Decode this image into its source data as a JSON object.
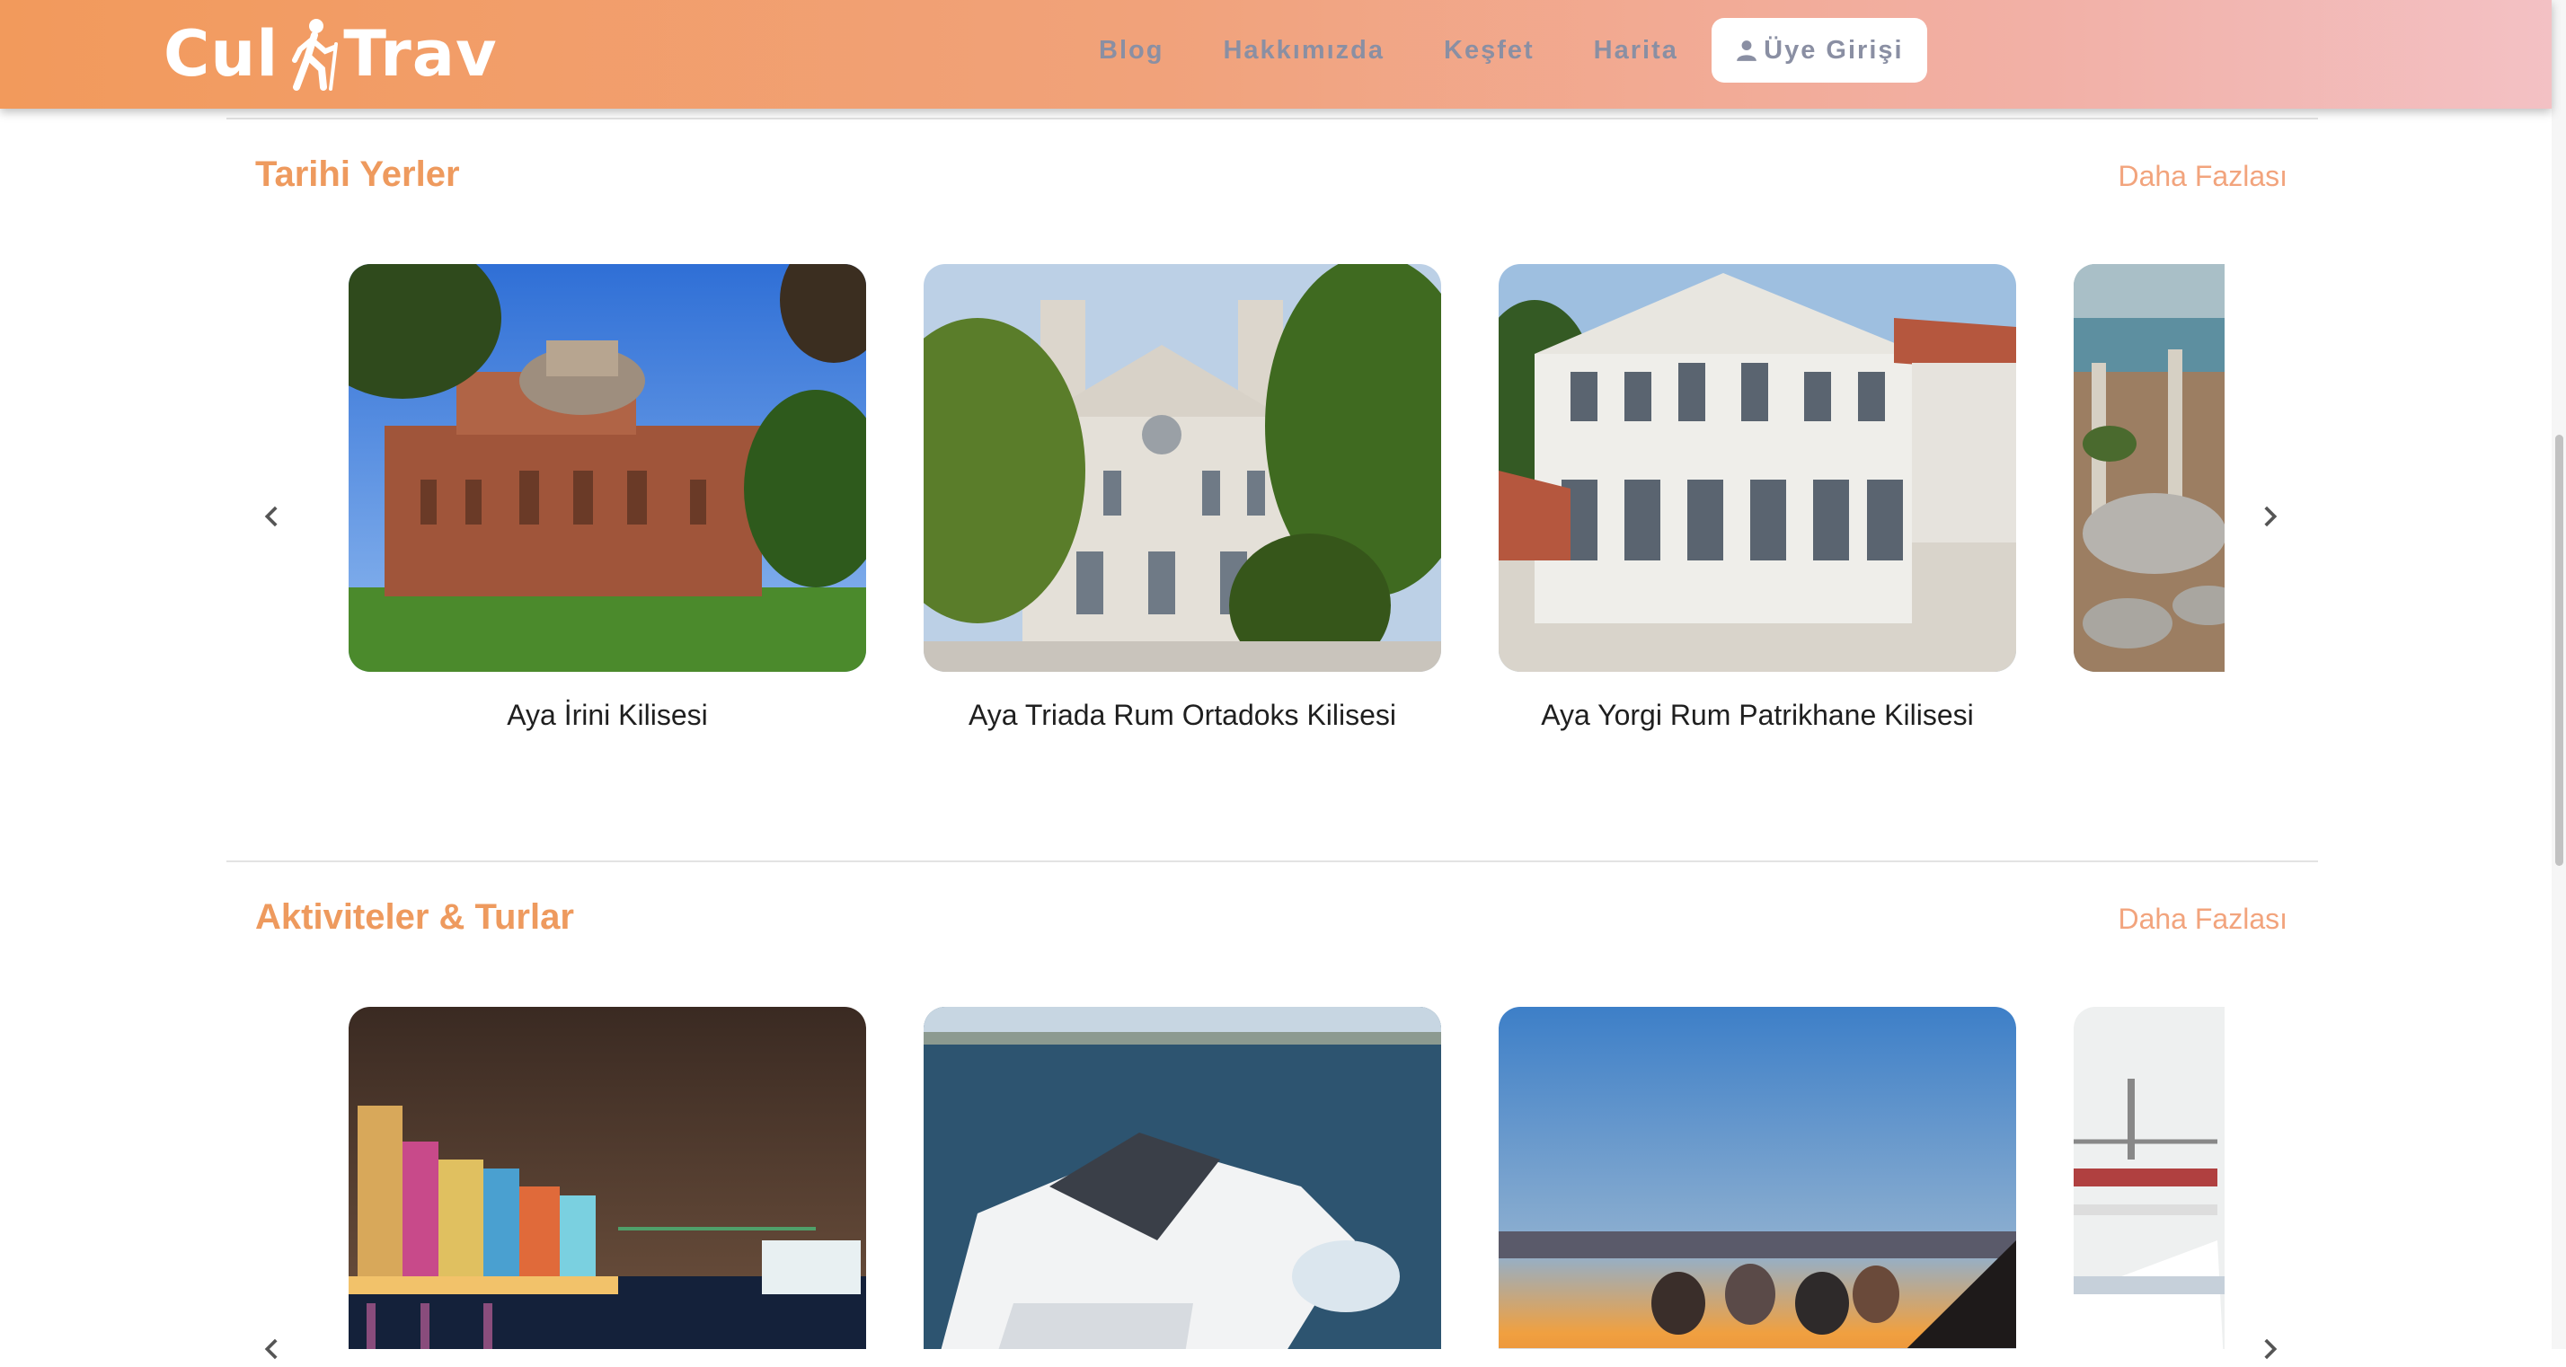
{
  "brand": {
    "logo_left": "Cul",
    "logo_right": "Trav"
  },
  "nav": {
    "items": [
      {
        "label": "Blog"
      },
      {
        "label": "Hakkımızda"
      },
      {
        "label": "Keşfet"
      },
      {
        "label": "Harita"
      }
    ],
    "login_label": "Üye Girişi"
  },
  "sections": [
    {
      "title": "Tarihi Yerler",
      "more_label": "Daha Fazlası",
      "cards": [
        {
          "title": "Aya İrini Kilisesi",
          "image": "byzantine-brick-church-photo"
        },
        {
          "title": "Aya Triada Rum Ortadoks Kilisesi",
          "image": "twin-tower-church-facade-photo"
        },
        {
          "title": "Aya Yorgi Rum Patrikhane Kilisesi",
          "image": "patriarchate-building-photo"
        },
        {
          "title": "",
          "image": "mosque-aerial-photo"
        }
      ]
    },
    {
      "title": "Aktiviteler & Turlar",
      "more_label": "Daha Fazlası",
      "cards": [
        {
          "title": "",
          "image": "night-waterfront-lights-photo"
        },
        {
          "title": "",
          "image": "yacht-bosphorus-photo"
        },
        {
          "title": "",
          "image": "sunset-boat-tour-photo"
        },
        {
          "title": "",
          "image": "bosphorus-bridge-yacht-photo"
        }
      ]
    }
  ],
  "colors": {
    "accent": "#ee9a5e",
    "nav_text": "#8a8fa3",
    "header_start": "#f29a5c",
    "header_end": "#f3c1c4"
  }
}
